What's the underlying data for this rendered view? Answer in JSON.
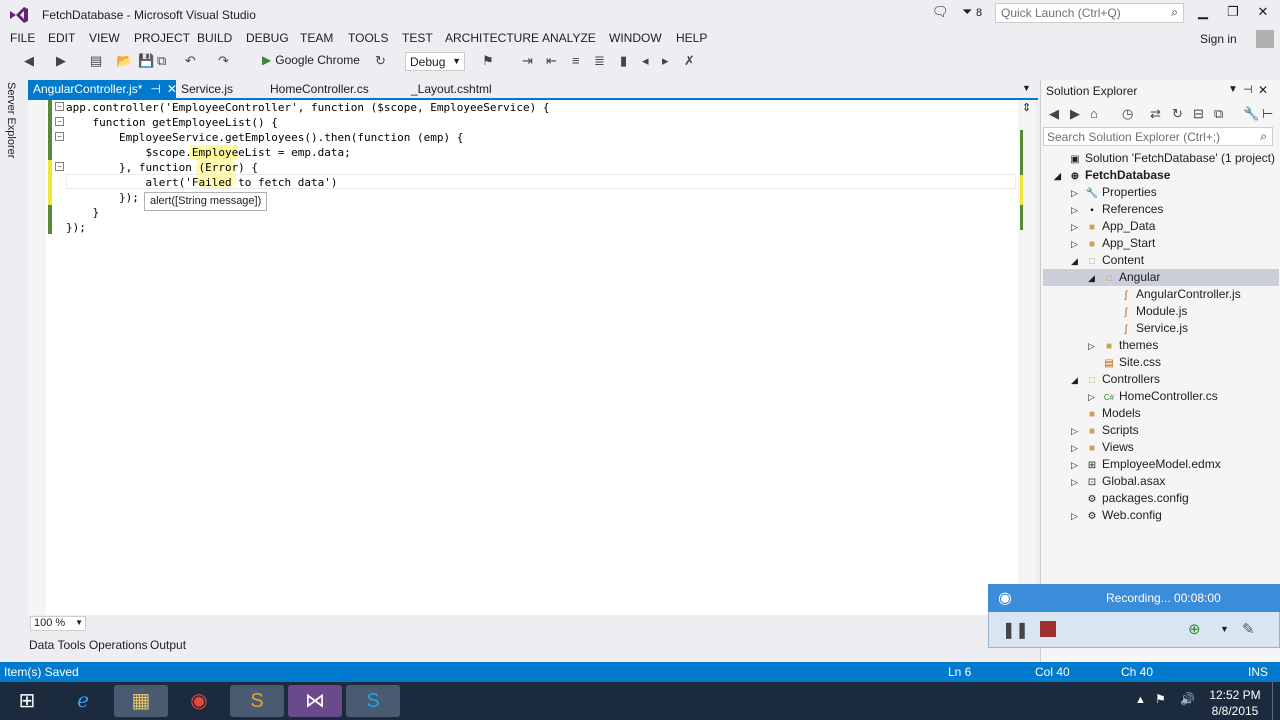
{
  "window": {
    "title": "FetchDatabase - Microsoft Visual Studio",
    "notifications_count": "8",
    "quick_launch_placeholder": "Quick Launch (Ctrl+Q)"
  },
  "menu": [
    "FILE",
    "EDIT",
    "VIEW",
    "PROJECT",
    "BUILD",
    "DEBUG",
    "TEAM",
    "TOOLS",
    "TEST",
    "ARCHITECTURE",
    "ANALYZE",
    "WINDOW",
    "HELP"
  ],
  "account": {
    "sign_in": "Sign in"
  },
  "toolbar": {
    "run_target": "Google Chrome",
    "configuration": "Debug"
  },
  "side_panel": {
    "server_explorer": "Server Explorer"
  },
  "tabs": [
    "AngularController.js*",
    "Service.js",
    "HomeController.cs",
    "_Layout.cshtml"
  ],
  "code_lines": [
    "app.controller('EmployeeController', function ($scope, EmployeeService) {",
    "    function getEmployeeList() {",
    "        EmployeeService.getEmployees().then(function (emp) {",
    "            $scope.EmployeeList = emp.data;",
    "        }, function (Error) {",
    "            alert('Failed to fetch data')",
    "        });",
    "    }",
    "});"
  ],
  "intellisense": {
    "tooltip": "alert([String message])"
  },
  "zoom": "100 %",
  "bottom_tabs": {
    "data_tools": "Data Tools Operations",
    "output": "Output"
  },
  "status": {
    "message": "Item(s) Saved",
    "line": "Ln 6",
    "col": "Col 40",
    "ch": "Ch 40",
    "mode": "INS"
  },
  "solution_explorer": {
    "title": "Solution Explorer",
    "search_placeholder": "Search Solution Explorer (Ctrl+;)",
    "items": [
      {
        "label": "Solution 'FetchDatabase' (1 project)",
        "icon": "solution-icon"
      },
      {
        "label": "FetchDatabase",
        "icon": "project-icon"
      },
      {
        "label": "Properties",
        "icon": "wrench-icon"
      },
      {
        "label": "References",
        "icon": "references-icon"
      },
      {
        "label": "App_Data",
        "icon": "folder-icon"
      },
      {
        "label": "App_Start",
        "icon": "folder-icon"
      },
      {
        "label": "Content",
        "icon": "folder-open-icon"
      },
      {
        "label": "Angular",
        "icon": "folder-open-icon"
      },
      {
        "label": "AngularController.js",
        "icon": "js-file-icon"
      },
      {
        "label": "Module.js",
        "icon": "js-file-icon"
      },
      {
        "label": "Service.js",
        "icon": "js-file-icon"
      },
      {
        "label": "themes",
        "icon": "folder-icon"
      },
      {
        "label": "Site.css",
        "icon": "css-file-icon"
      },
      {
        "label": "Controllers",
        "icon": "folder-open-icon"
      },
      {
        "label": "HomeController.cs",
        "icon": "csharp-file-icon"
      },
      {
        "label": "Models",
        "icon": "folder-icon"
      },
      {
        "label": "Scripts",
        "icon": "folder-icon"
      },
      {
        "label": "Views",
        "icon": "folder-icon"
      },
      {
        "label": "EmployeeModel.edmx",
        "icon": "edmx-file-icon"
      },
      {
        "label": "Global.asax",
        "icon": "asax-file-icon"
      },
      {
        "label": "packages.config",
        "icon": "config-file-icon"
      },
      {
        "label": "Web.config",
        "icon": "config-file-icon"
      }
    ]
  },
  "recorder": {
    "status": "Recording... 00:08:00"
  },
  "clock": {
    "time": "12:52 PM",
    "date": "8/8/2015"
  }
}
